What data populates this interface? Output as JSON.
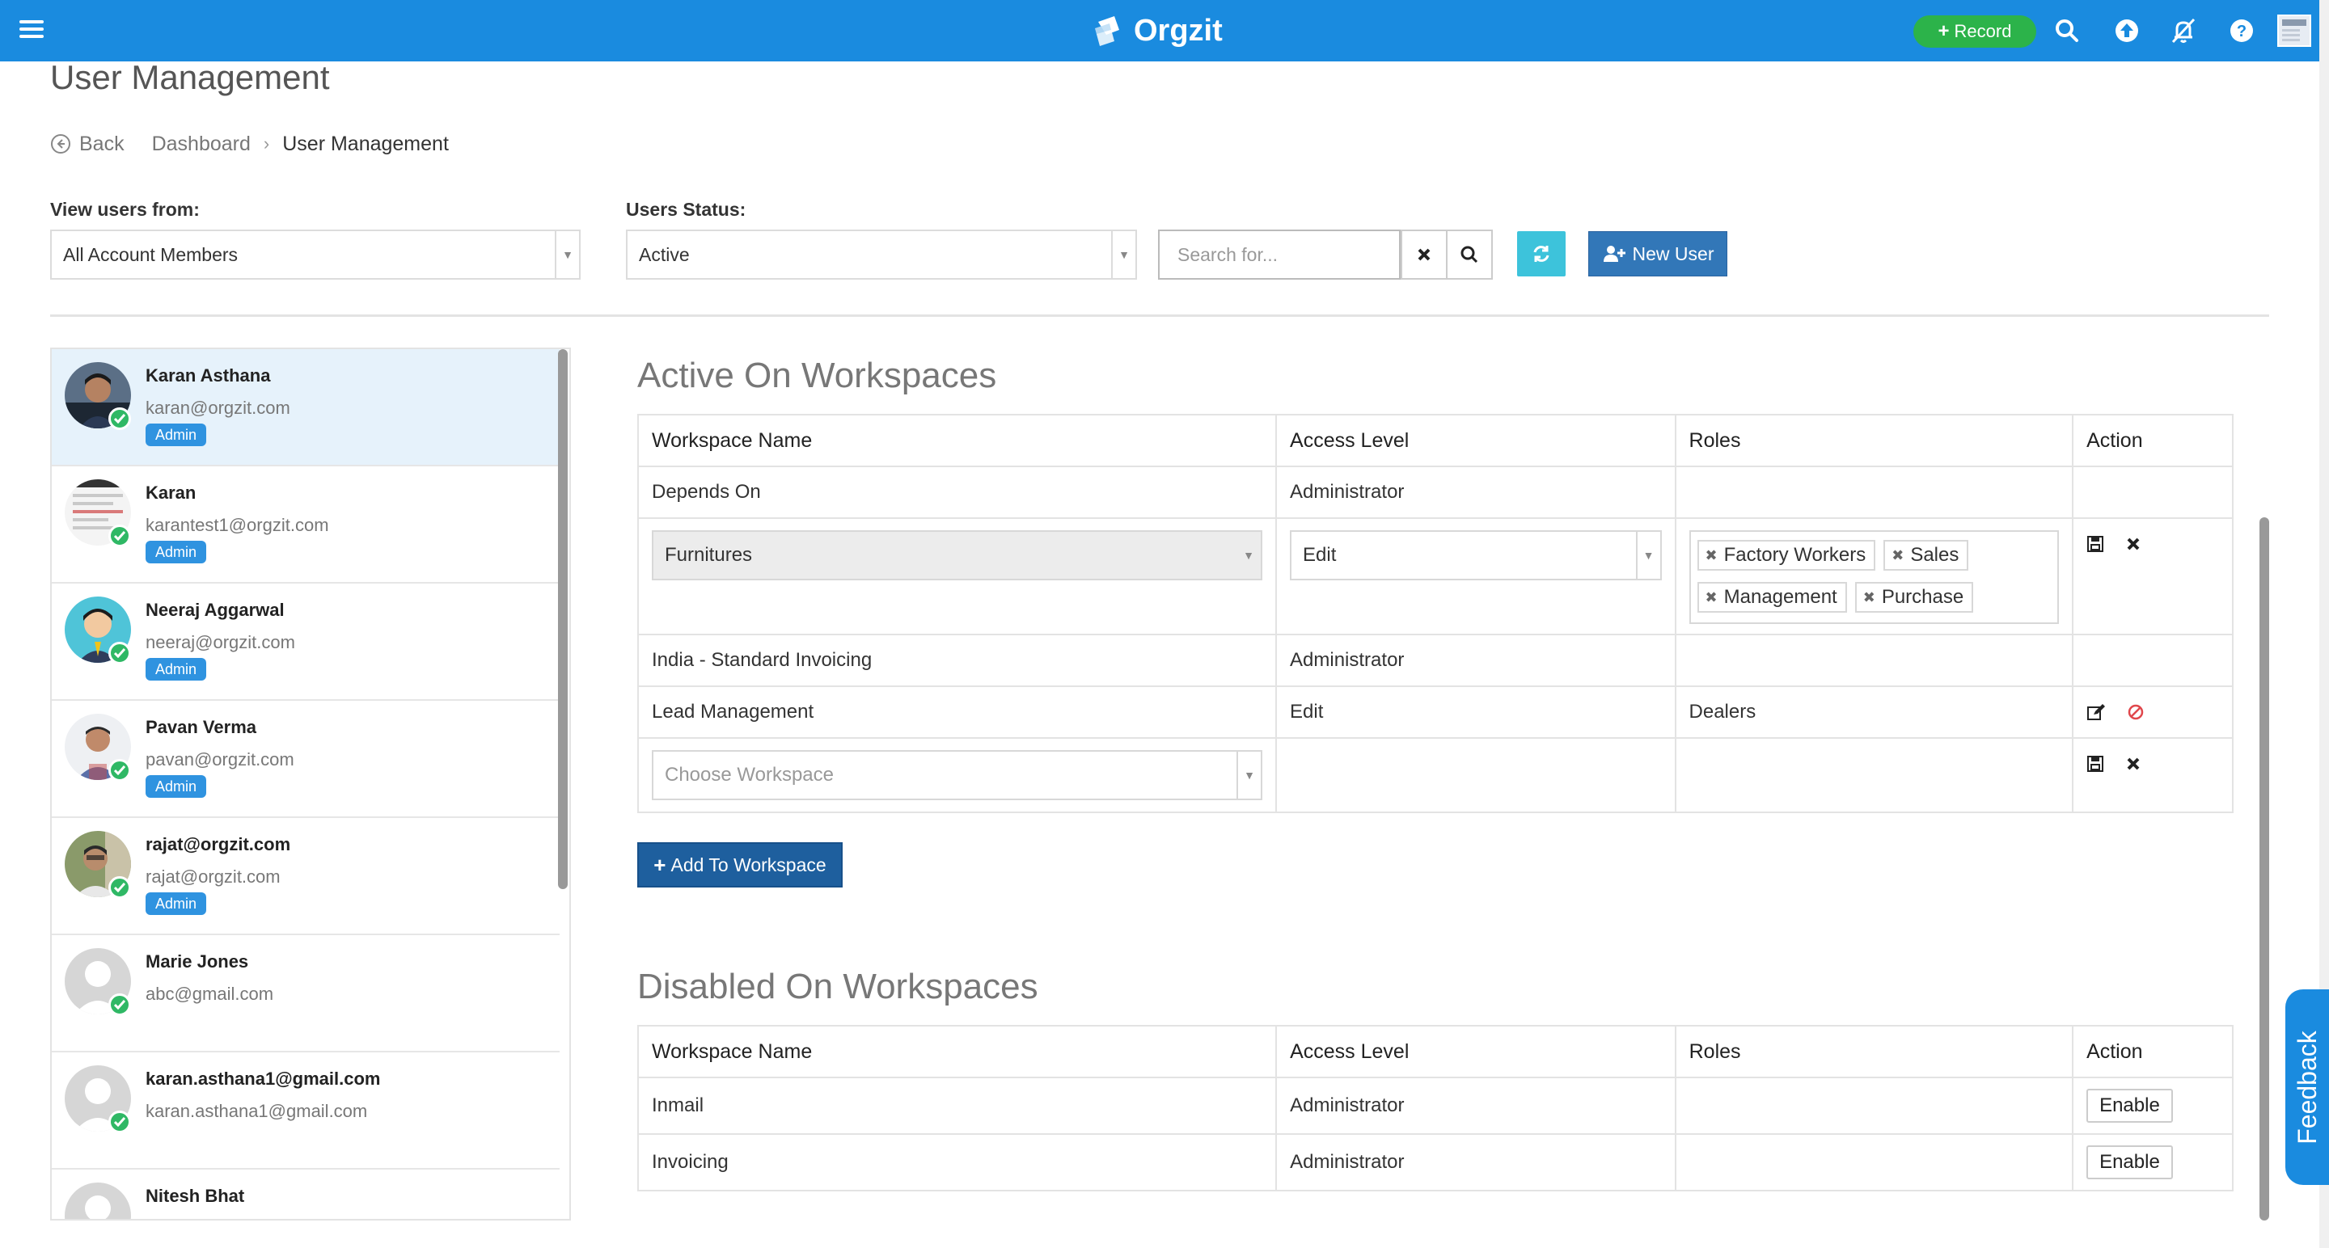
{
  "navbar": {
    "menu_icon": "hamburger-icon",
    "brand": "Orgzit",
    "record_label": "Record",
    "icons": [
      "search-icon",
      "upload-icon",
      "notifications-off-icon",
      "help-icon",
      "user-avatar"
    ],
    "color": "#1a8bdf"
  },
  "page": {
    "title": "User Management",
    "breadcrumb": {
      "back": "Back",
      "dashboard": "Dashboard",
      "current": "User Management"
    }
  },
  "filters": {
    "view_users_label": "View users from:",
    "view_users_value": "All Account Members",
    "status_label": "Users Status:",
    "status_value": "Active",
    "search_placeholder": "Search for...",
    "new_user_label": "New User"
  },
  "users": [
    {
      "name": "Karan Asthana",
      "email": "karan@orgzit.com",
      "badge": "Admin",
      "avatar": "photo",
      "selected": true
    },
    {
      "name": "Karan",
      "email": "karantest1@orgzit.com",
      "badge": "Admin",
      "avatar": "screenshot"
    },
    {
      "name": "Neeraj Aggarwal",
      "email": "neeraj@orgzit.com",
      "badge": "Admin",
      "avatar": "cartoon"
    },
    {
      "name": "Pavan Verma",
      "email": "pavan@orgzit.com",
      "badge": "Admin",
      "avatar": "photo"
    },
    {
      "name": "rajat@orgzit.com",
      "email": "rajat@orgzit.com",
      "badge": "Admin",
      "avatar": "photo"
    },
    {
      "name": "Marie Jones",
      "email": "abc@gmail.com",
      "badge": "",
      "avatar": "placeholder"
    },
    {
      "name": "karan.asthana1@gmail.com",
      "email": "karan.asthana1@gmail.com",
      "badge": "",
      "avatar": "placeholder"
    },
    {
      "name": "Nitesh Bhat",
      "email": "",
      "badge": "",
      "avatar": "placeholder"
    }
  ],
  "active": {
    "title": "Active On Workspaces",
    "headers": {
      "workspace": "Workspace Name",
      "access": "Access Level",
      "roles": "Roles",
      "action": "Action"
    },
    "rows": [
      {
        "workspace": "Depends On",
        "access": "Administrator",
        "roles": ""
      },
      {
        "workspace": "Furnitures",
        "access": "Edit",
        "roles": [
          "Factory Workers",
          "Sales",
          "Management",
          "Purchase"
        ],
        "editing": true
      },
      {
        "workspace": "India - Standard Invoicing",
        "access": "Administrator",
        "roles": ""
      },
      {
        "workspace": "Lead Management",
        "access": "Edit",
        "roles": "Dealers"
      }
    ],
    "new_row_placeholder": "Choose Workspace",
    "add_button": "Add To Workspace"
  },
  "disabled": {
    "title": "Disabled On Workspaces",
    "headers": {
      "workspace": "Workspace Name",
      "access": "Access Level",
      "roles": "Roles",
      "action": "Action"
    },
    "rows": [
      {
        "workspace": "Inmail",
        "access": "Administrator",
        "roles": "",
        "action": "Enable"
      },
      {
        "workspace": "Invoicing",
        "access": "Administrator",
        "roles": "",
        "action": "Enable"
      }
    ]
  },
  "feedback_label": "Feedback",
  "colors": {
    "primary": "#1a8bdf",
    "record": "#2cb34a",
    "refresh": "#3dc3db",
    "new_user": "#3277b8",
    "check": "#2fb865",
    "danger": "#e0474c"
  }
}
